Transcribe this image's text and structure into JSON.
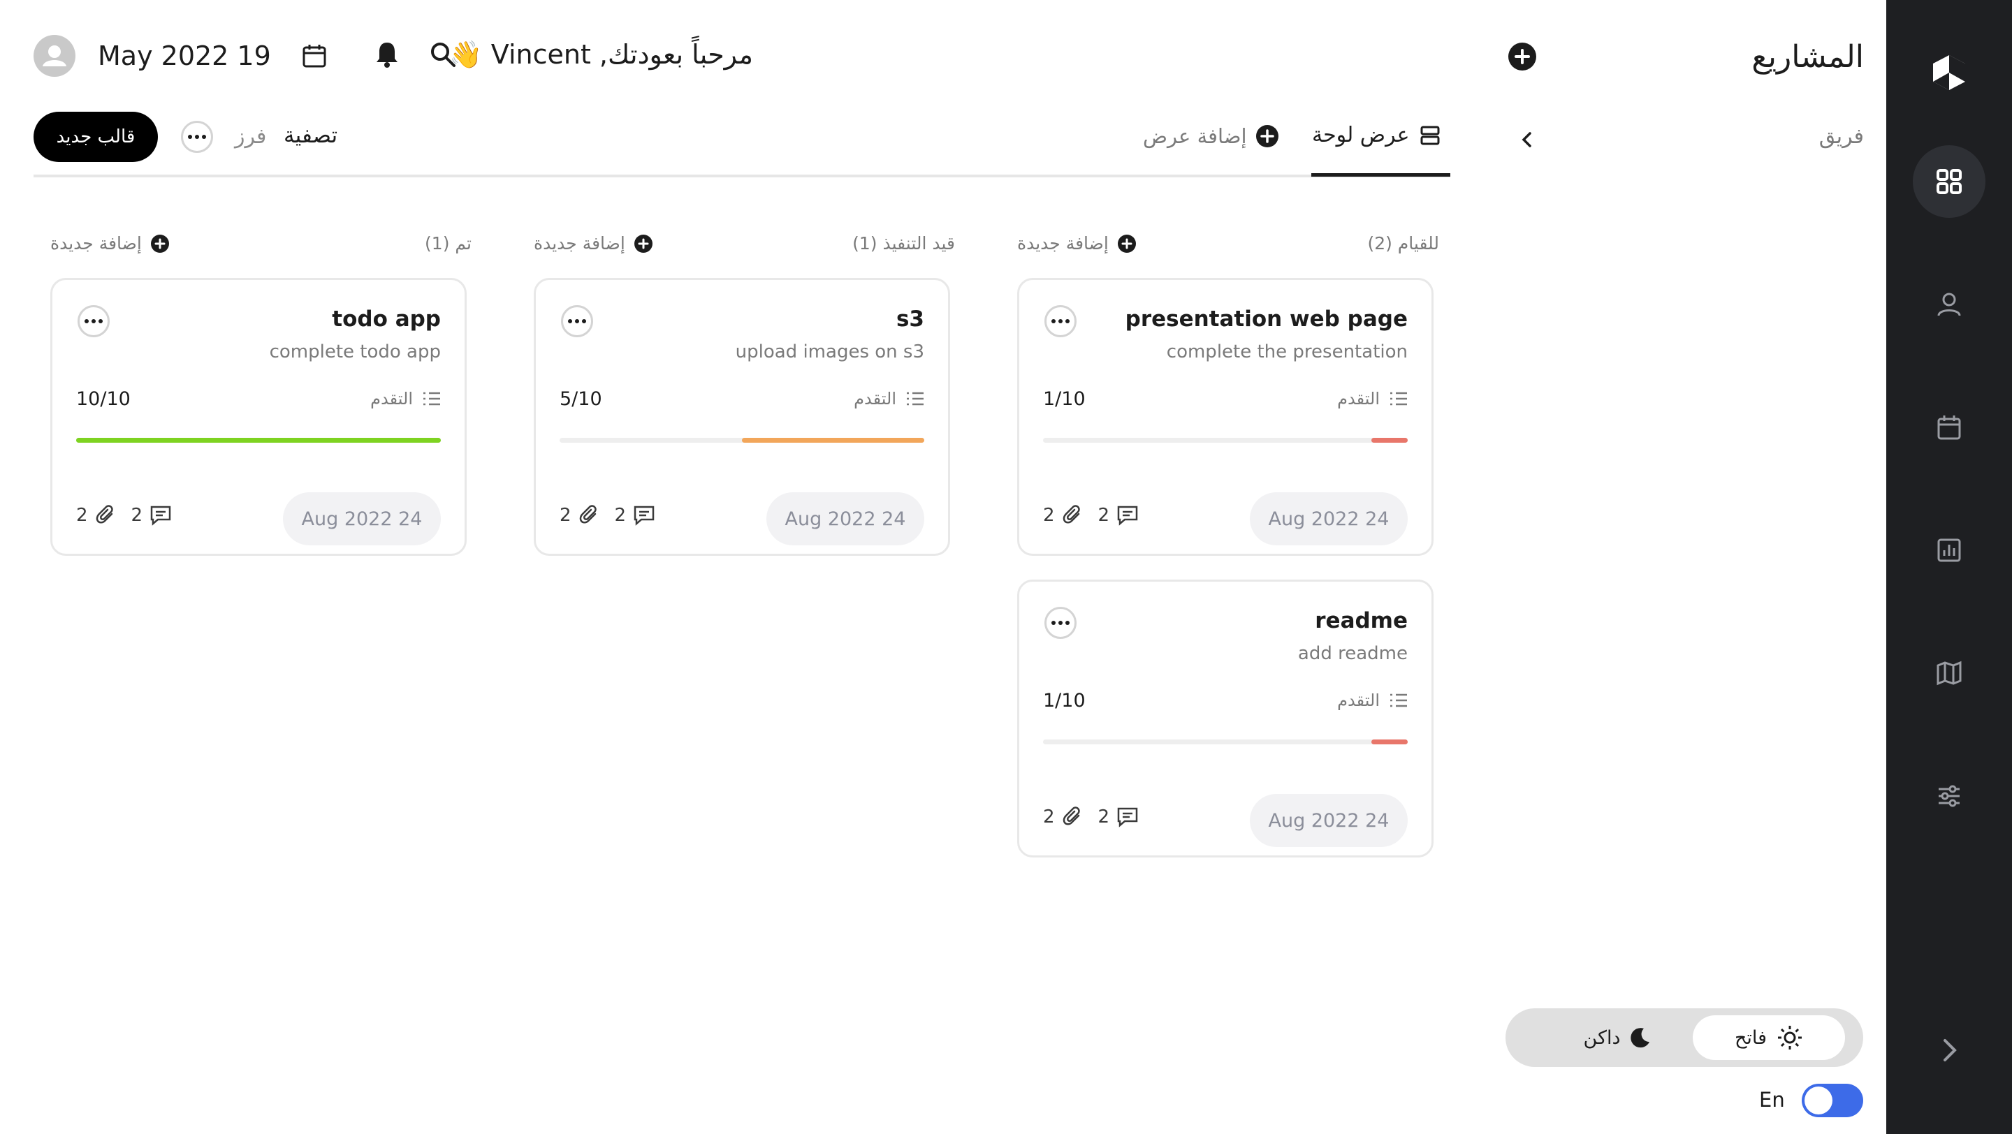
{
  "sidebar": {
    "title": "المشاريع",
    "team_label": "فريق"
  },
  "header": {
    "greeting": "مرحباً بعودتك, Vincent 👋",
    "date": "May 2022 19"
  },
  "tabs": {
    "board_view": "عرض لوحة",
    "add_view": "إضافة عرض",
    "filter": "تصفية",
    "sort": "فرز",
    "new_template": "قالب جديد"
  },
  "columns": [
    {
      "title": "للقيام (2)",
      "add_label": "إضافة جديدة",
      "cards": [
        {
          "title": "presentation web page",
          "desc": "complete the presentation",
          "progress_label": "التقدم",
          "progress_value": "1/10",
          "progress": 0.1,
          "color": "#e8766a",
          "date": "Aug 2022 24",
          "comments": "2",
          "attachments": "2"
        },
        {
          "title": "readme",
          "desc": "add readme",
          "progress_label": "التقدم",
          "progress_value": "1/10",
          "progress": 0.1,
          "color": "#e8766a",
          "date": "Aug 2022 24",
          "comments": "2",
          "attachments": "2"
        }
      ]
    },
    {
      "title": "قيد التنفيذ (1)",
      "add_label": "إضافة جديدة",
      "cards": [
        {
          "title": "s3",
          "desc": "upload images on s3",
          "progress_label": "التقدم",
          "progress_value": "5/10",
          "progress": 0.5,
          "color": "#f2a65a",
          "date": "Aug 2022 24",
          "comments": "2",
          "attachments": "2"
        }
      ]
    },
    {
      "title": "تم (1)",
      "add_label": "إضافة جديدة",
      "cards": [
        {
          "title": "todo app",
          "desc": "complete todo app",
          "progress_label": "التقدم",
          "progress_value": "10/10",
          "progress": 1.0,
          "color": "#7ed321",
          "date": "Aug 2022 24",
          "comments": "2",
          "attachments": "2"
        }
      ]
    }
  ],
  "theme": {
    "light": "فاتح",
    "dark": "داكن"
  },
  "language": {
    "label": "En"
  },
  "colors": {
    "rail_bg": "#1e1f22",
    "toggle_blue": "#3d6be8",
    "primary_black": "#000000"
  }
}
